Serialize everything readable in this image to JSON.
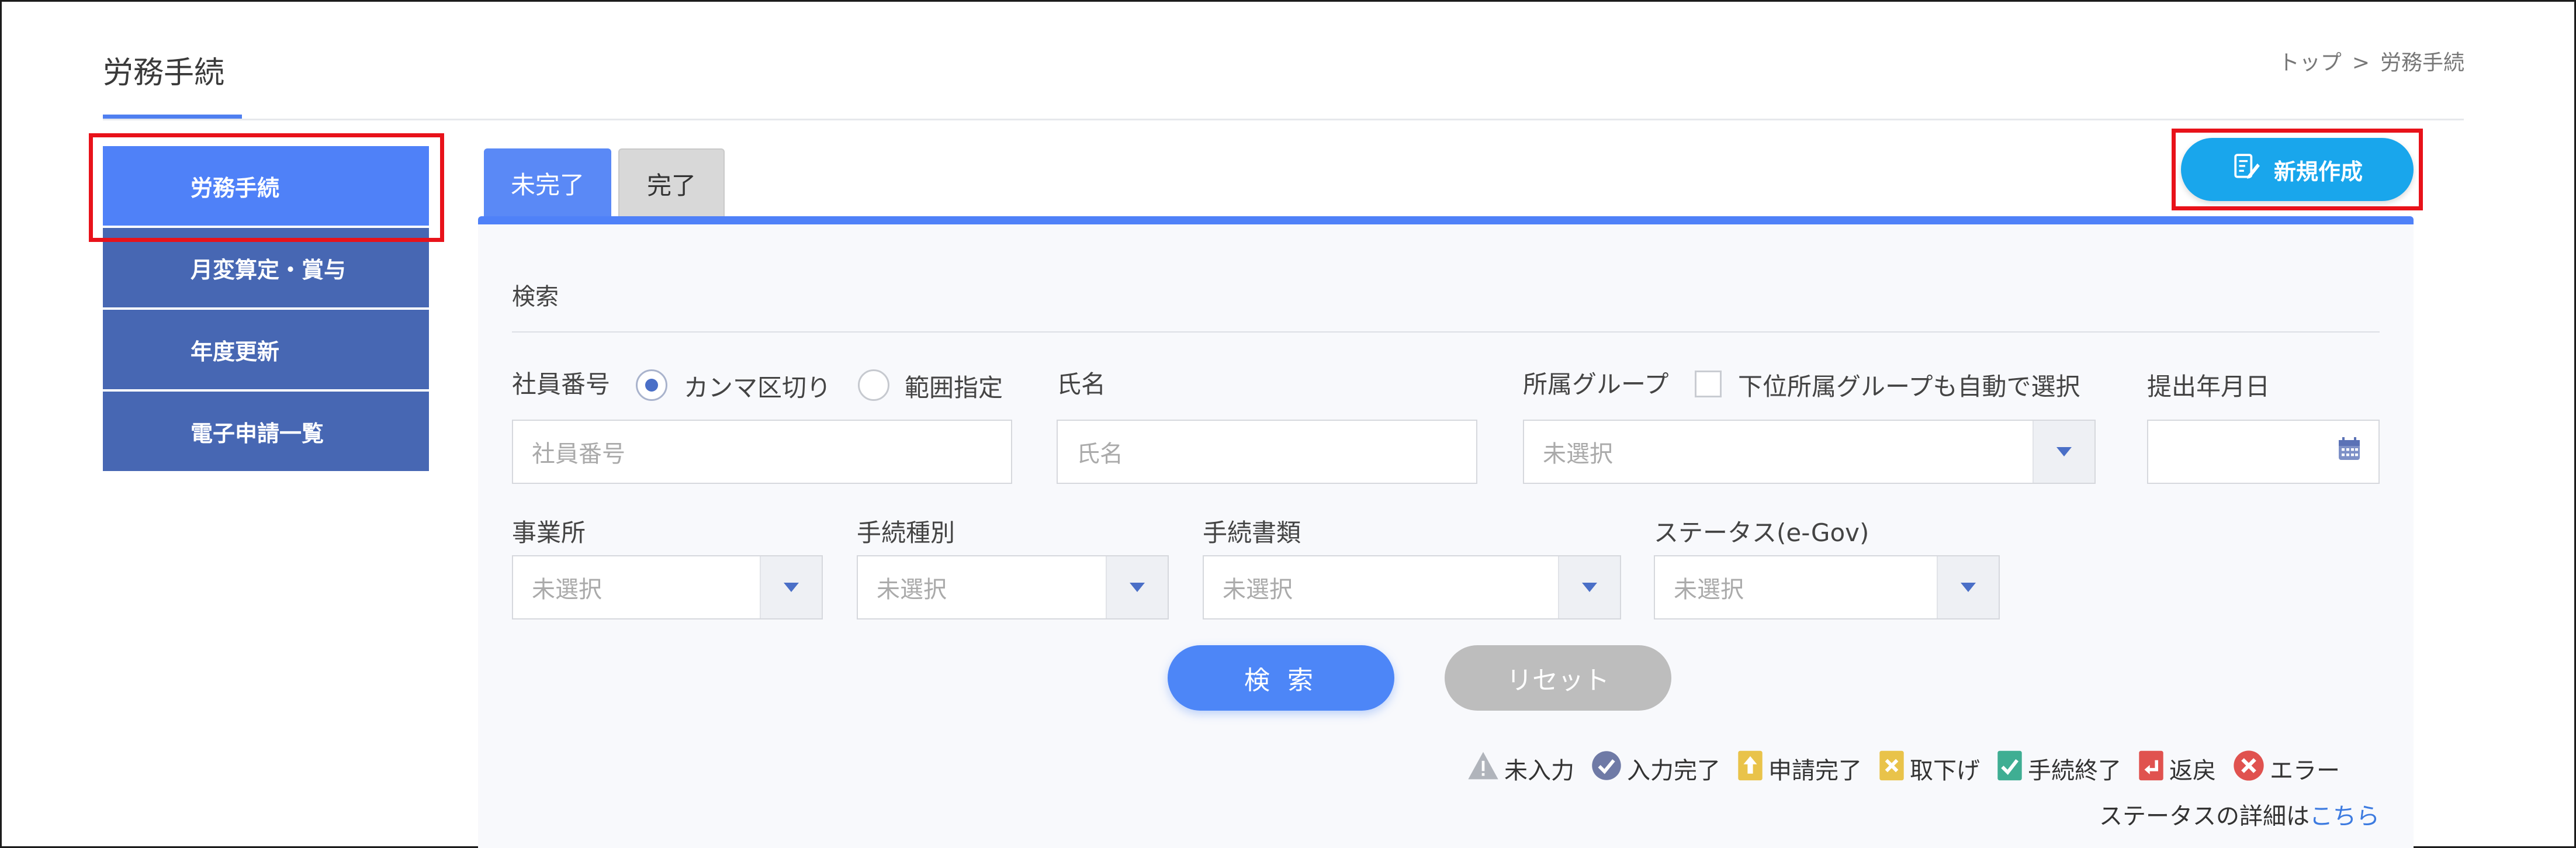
{
  "header": {
    "title": "労務手続",
    "breadcrumb": {
      "home": "トップ",
      "separator": ">",
      "current": "労務手続"
    }
  },
  "sidebar": {
    "items": [
      {
        "label": "労務手続",
        "active": true
      },
      {
        "label": "月変算定・賞与",
        "active": false
      },
      {
        "label": "年度更新",
        "active": false
      },
      {
        "label": "電子申請一覧",
        "active": false
      }
    ]
  },
  "tabs": [
    {
      "label": "未完了",
      "active": true
    },
    {
      "label": "完了",
      "active": false
    }
  ],
  "new_button": {
    "label": "新規作成",
    "icon": "document-edit-icon"
  },
  "search": {
    "title": "検索",
    "employee_number": {
      "label": "社員番号",
      "options": [
        "カンマ区切り",
        "範囲指定"
      ],
      "selected": "カンマ区切り",
      "placeholder": "社員番号"
    },
    "name": {
      "label": "氏名",
      "placeholder": "氏名"
    },
    "group": {
      "label": "所属グループ",
      "sub_checkbox_label": "下位所属グループも自動で選択",
      "value": "未選択"
    },
    "submit_date": {
      "label": "提出年月日",
      "icon": "calendar-icon"
    },
    "office": {
      "label": "事業所",
      "value": "未選択"
    },
    "procedure_type": {
      "label": "手続種別",
      "value": "未選択"
    },
    "procedure_doc": {
      "label": "手続書類",
      "value": "未選択"
    },
    "status": {
      "label": "ステータス(e-Gov)",
      "value": "未選択"
    },
    "search_button": "検 索",
    "reset_button": "リセット"
  },
  "legend": [
    {
      "label": "未入力",
      "icon": "warning-icon",
      "color": "#b0b4bb"
    },
    {
      "label": "入力完了",
      "icon": "check-circle-icon",
      "color": "#6f7aa6"
    },
    {
      "label": "申請完了",
      "icon": "upload-doc-icon",
      "color": "#e9c34a"
    },
    {
      "label": "取下げ",
      "icon": "withdraw-doc-icon",
      "color": "#e9c34a"
    },
    {
      "label": "手続終了",
      "icon": "done-doc-icon",
      "color": "#3fae93"
    },
    {
      "label": "返戻",
      "icon": "return-doc-icon",
      "color": "#e0524f"
    },
    {
      "label": "エラー",
      "icon": "error-icon",
      "color": "#e0524f"
    }
  ],
  "status_detail": {
    "text": "ステータスの詳細は",
    "link": "こちら"
  },
  "colors": {
    "accent": "#4f81f8",
    "sidebar": "#4767b3",
    "new_button": "#19a6ec",
    "highlight_box": "#e8121a"
  }
}
